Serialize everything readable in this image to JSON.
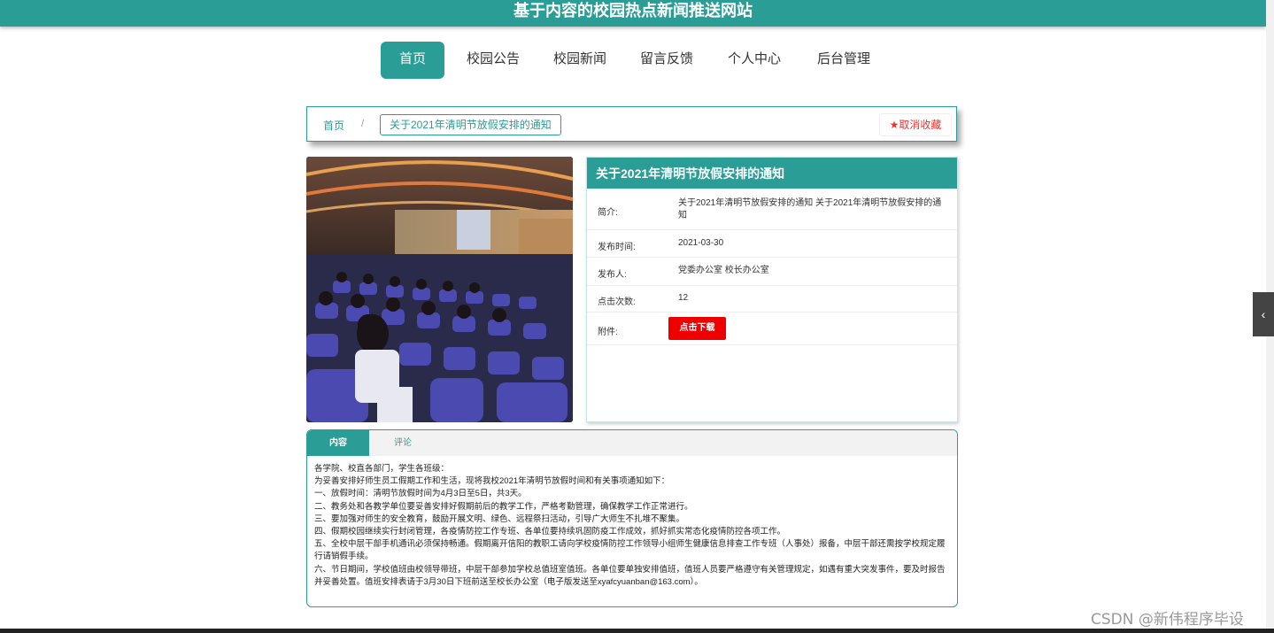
{
  "site": {
    "title": "基于内容的校园热点新闻推送网站"
  },
  "nav": {
    "items": [
      "首页",
      "校园公告",
      "校园新闻",
      "留言反馈",
      "个人中心",
      "后台管理"
    ],
    "active": "首页"
  },
  "breadcrumb": {
    "home": "首页",
    "separator": "/",
    "current": "关于2021年清明节放假安排的通知"
  },
  "favorite": {
    "label": "取消收藏"
  },
  "article": {
    "title": "关于2021年清明节放假安排的通知",
    "fields": {
      "intro_label": "简介:",
      "intro_value": "关于2021年清明节放假安排的通知 关于2021年清明节放假安排的通知",
      "date_label": "发布时间:",
      "date_value": "2021-03-30",
      "publisher_label": "发布人:",
      "publisher_value": "党委办公室 校长办公室",
      "clicks_label": "点击次数:",
      "clicks_value": "12",
      "attachment_label": "附件:",
      "download_label": "点击下载"
    }
  },
  "tabs": {
    "content": "内容",
    "comments": "评论"
  },
  "content": {
    "lines": [
      "各学院、校直各部门，学生各班级：",
      "    为妥善安排好师生员工假期工作和生活，现将我校2021年清明节放假时间和有关事项通知如下：",
      "    一、放假时间：清明节放假时间为4月3日至5日，共3天。",
      "    二、教务处和各教学单位要妥善安排好假期前后的教学工作，严格考勤管理，确保教学工作正常进行。",
      "    三、要加强对师生的安全教育，鼓励开展文明、绿色、远程祭扫活动，引导广大师生不扎堆不聚集。",
      "    四、假期校园继续实行封闭管理，各疫情防控工作专班、各单位要持续巩固防疫工作成效，抓好抓实常态化疫情防控各项工作。",
      "    五、全校中层干部手机通讯必须保持畅通。假期离开信阳的教职工请向学校疫情防控工作领导小组师生健康信息排查工作专班（人事处）报备，中层干部还需按学校规定履行请销假手续。",
      "    六、节日期间，学校值班由校领导带班，中层干部参加学校总值班室值班。各单位要单独安排值班，值班人员要严格遵守有关管理规定，如遇有重大突发事件，要及时报告并妥善处置。值班安排表请于3月30日下班前送至校长办公室（电子版发送至xyafcyuanban@163.com）。"
    ]
  },
  "watermark": "CSDN @新伟程序毕设",
  "colors": {
    "accent": "#2a9d96",
    "danger": "#ee0000"
  }
}
